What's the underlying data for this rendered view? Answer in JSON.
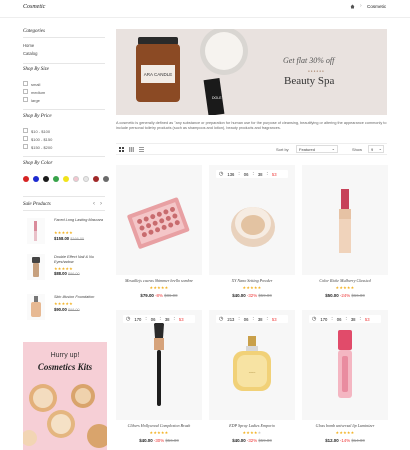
{
  "header": {
    "logo": "Cosmetic",
    "breadcrumb_sep": "›",
    "breadcrumb_current": "Cosmetic"
  },
  "sidebar": {
    "categories_title": "Categories",
    "categories": [
      "Home",
      "Catalog"
    ],
    "size_title": "Shop By Size",
    "sizes": [
      "small",
      "medium",
      "large"
    ],
    "price_title": "Shop By Price",
    "prices": [
      "$10 - $100",
      "$100 - $150",
      "$150 - $200"
    ],
    "color_title": "Shop By Color",
    "colors": [
      "#d62323",
      "#1d2bd0",
      "#1a1a1a",
      "#38a34a",
      "#f1e31b",
      "#f3c6cf",
      "#e6e6e6",
      "#a02929",
      "#6a6a6a"
    ],
    "sale_title": "Sale Products",
    "sale_prev": "‹",
    "sale_next": "›",
    "sale_products": [
      {
        "name": "Faced Long Lasting Mascara",
        "price": "$158.00",
        "old": "$166.00"
      },
      {
        "name": "Double Effect Nail & Nu Eyeshadow",
        "price": "$88.00",
        "old": "$96.00"
      },
      {
        "name": "Skin Illusion Foundation",
        "price": "$90.00",
        "old": "$98.00"
      }
    ],
    "promo_line1": "Hurry up!",
    "promo_line2": "Cosmetics Kits"
  },
  "hero": {
    "candle_label": "ARA CANDLE",
    "box_label": "DOLE",
    "offer": "Get flat 30% off",
    "dots": "●●●●●●",
    "title": "Beauty Spa"
  },
  "description": "A cosmetic is generally defined as \"any substance or preparation for human use for the purpose of cleansing, beautifying or altering the appearance commonly to include personal toiletry products (such as shampoos and lotion), beauty products and fragrances.",
  "toolbar": {
    "sort_label": "Sort by",
    "sort_value": "Featured",
    "show_label": "Show",
    "show_value": "9"
  },
  "accent": "#e33333",
  "products": [
    {
      "name": "Mesaillejs cacras Shimmer brello sombre",
      "stars": "★★★★★",
      "price": "$79.00",
      "discount": "-8%",
      "old": "$86.00",
      "timer": null
    },
    {
      "name": "XY Nano Setting Powder",
      "stars": "★★★★★",
      "price": "$40.00",
      "discount": "-32%",
      "old": "$59.00",
      "timer": [
        "136",
        "06",
        "38",
        "53"
      ]
    },
    {
      "name": "Color Ricke Mulberry Classicd",
      "stars": "★★★★★",
      "price": "$50.00",
      "discount": "-24%",
      "old": "$66.00",
      "timer": null
    },
    {
      "name": "Clibers Hollywood Complexion Brush",
      "stars": "★★★★★",
      "price": "$40.00",
      "discount": "-30%",
      "old": "$56.00",
      "timer": [
        "170",
        "06",
        "38",
        "53"
      ]
    },
    {
      "name": "EDP Spray Ladies Emporio",
      "stars": "★★★★",
      "price": "$40.00",
      "discount": "-32%",
      "old": "$59.00",
      "timer": [
        "213",
        "06",
        "38",
        "53"
      ]
    },
    {
      "name": "Gloss bomb universal lip Luminizer",
      "stars": "★★★★★",
      "price": "$12.00",
      "discount": "-14%",
      "old": "$14.00",
      "timer": [
        "170",
        "06",
        "38",
        "53"
      ]
    }
  ]
}
